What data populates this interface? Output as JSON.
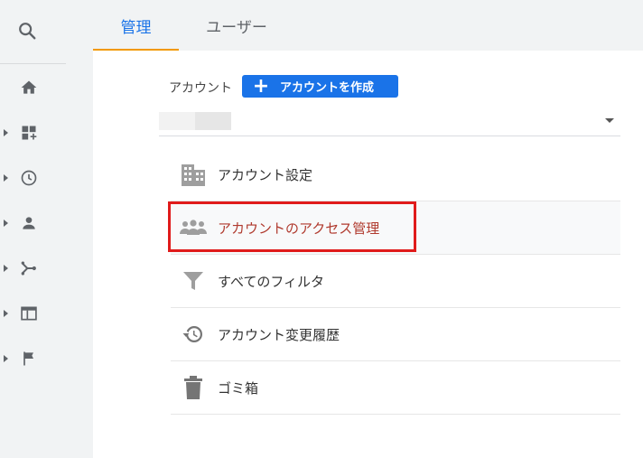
{
  "tabs": [
    {
      "label": "管理",
      "active": true
    },
    {
      "label": "ユーザー",
      "active": false
    }
  ],
  "account": {
    "label": "アカウント",
    "create_button": "アカウントを作成"
  },
  "menu": [
    {
      "label": "アカウント設定",
      "icon": "building-icon"
    },
    {
      "label": "アカウントのアクセス管理",
      "icon": "people-icon"
    },
    {
      "label": "すべてのフィルタ",
      "icon": "filter-icon"
    },
    {
      "label": "アカウント変更履歴",
      "icon": "history-icon"
    },
    {
      "label": "ゴミ箱",
      "icon": "trash-icon"
    }
  ],
  "colors": {
    "accent": "#1a73e8",
    "tab_underline": "#f29900",
    "highlight_border": "#e01b1b"
  }
}
